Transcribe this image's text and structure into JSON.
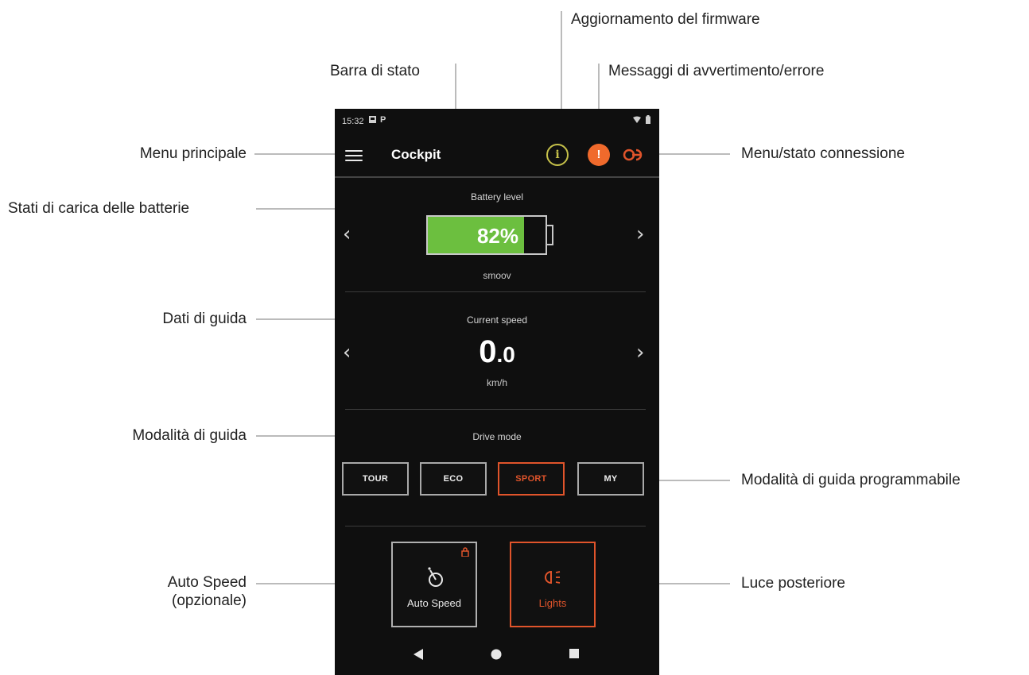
{
  "callouts": {
    "firmware": "Aggiornamento del firmware",
    "status_bar": "Barra di stato",
    "warnings": "Messaggi di avvertimento/errore",
    "main_menu": "Menu principale",
    "connection": "Menu/stato connessione",
    "battery_states": "Stati di carica delle batterie",
    "ride_data": "Dati di guida",
    "drive_mode": "Modalità di guida",
    "programmable_mode": "Modalità di guida programmabile",
    "auto_speed_line1": "Auto Speed",
    "auto_speed_line2": "(opzionale)",
    "rear_light": "Luce posteriore"
  },
  "phone": {
    "status": {
      "time": "15:32",
      "left_icon_1": "image-icon",
      "left_icon_2": "parking-icon",
      "right_icon_1": "wifi-icon",
      "right_icon_2": "battery-icon"
    },
    "appbar": {
      "title": "Cockpit",
      "menu_icon": "hamburger-menu-icon",
      "info_glyph": "i",
      "warning_glyph": "!",
      "connection_icon": "link-icon"
    },
    "battery": {
      "label": "Battery level",
      "percent_text": "82%",
      "percent": 82,
      "name": "smoov",
      "fill_color": "#6cbf3f"
    },
    "speed": {
      "label": "Current speed",
      "integer": "0",
      "decimal": ".0",
      "unit": "km/h"
    },
    "drive_mode": {
      "label": "Drive mode",
      "modes": [
        "TOUR",
        "ECO",
        "SPORT",
        "MY"
      ],
      "active": "SPORT",
      "accent": "#e0542b"
    },
    "tiles": {
      "auto_speed": {
        "label": "Auto Speed",
        "icon": "speedometer-icon",
        "badge": "lock-icon"
      },
      "lights": {
        "label": "Lights",
        "icon": "headlight-icon"
      }
    },
    "nav": {
      "back": "back-icon",
      "home": "home-icon",
      "recent": "recent-apps-icon"
    },
    "colors": {
      "info": "#c6c14a",
      "warning": "#f06a2c",
      "background": "#0f0f0f"
    }
  }
}
